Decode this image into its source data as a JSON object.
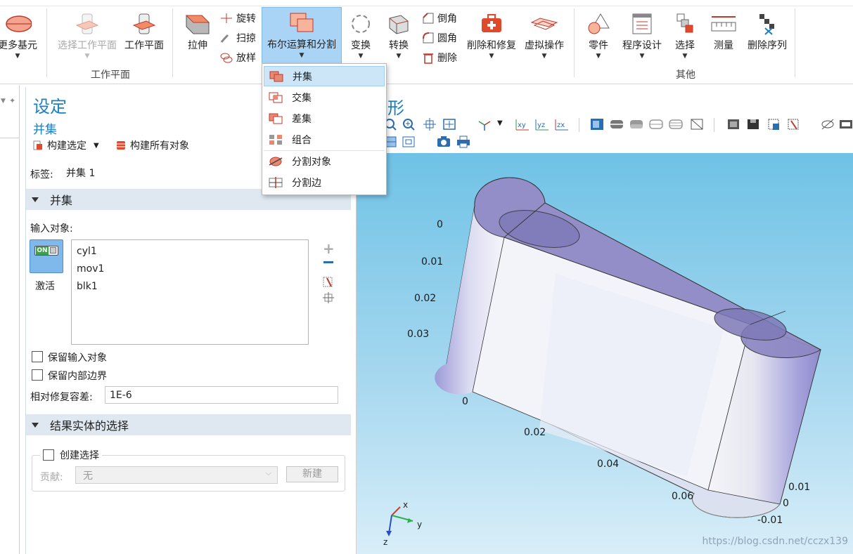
{
  "ribbon": {
    "more_primitives": "更多基元",
    "select_workplane": "选择工作平面",
    "workplane": "工作平面",
    "workplane_group": "工作平面",
    "extrude": "拉伸",
    "revolve": "旋转",
    "sweep": "扫掠",
    "loft": "放样",
    "booleans": "布尔运算和分割",
    "transforms": "变换",
    "conversions": "转换",
    "chamfer": "倒角",
    "fillet": "圆角",
    "delete": "删除",
    "defeaturing": "削除和修复",
    "virtual_ops": "虚拟操作",
    "parts": "零件",
    "programming": "程序设计",
    "selections": "选择",
    "measure": "测量",
    "delete_sequence": "删除序列",
    "other_group": "其他"
  },
  "dropdown": {
    "items": [
      {
        "label": "并集",
        "icon": "union-icon",
        "selected": true
      },
      {
        "label": "交集",
        "icon": "intersection-icon",
        "selected": false
      },
      {
        "label": "差集",
        "icon": "difference-icon",
        "selected": false
      },
      {
        "label": "组合",
        "icon": "compose-icon",
        "selected": false
      },
      {
        "label": "分割对象",
        "icon": "partition-objects-icon",
        "selected": false
      },
      {
        "label": "分割边",
        "icon": "partition-edges-icon",
        "selected": false
      }
    ]
  },
  "settings": {
    "title": "设定",
    "subtitle": "并集",
    "build_selected": "构建选定",
    "build_all": "构建所有对象",
    "label_caption": "标签:",
    "label_value": "并集 1",
    "section_union": "并集",
    "input_objects_caption": "输入对象:",
    "toggle_state": "ON",
    "activate": "激活",
    "input_objects": [
      "cyl1",
      "mov1",
      "blk1"
    ],
    "keep_input": "保留输入对象",
    "keep_interior": "保留内部边界",
    "repair_tol_caption": "相对修复容差:",
    "repair_tol_value": "1E-6",
    "section_result": "结果实体的选择",
    "create_selection": "创建选择",
    "contribute_caption": "贡献:",
    "contribute_value": "无",
    "new_button": "新建"
  },
  "graphics": {
    "title_fragment": "形",
    "axis_numbers": [
      "0",
      "0.01",
      "0.02",
      "0.03",
      "0",
      "0.02",
      "0.04",
      "0.06",
      "0.01",
      "0",
      "-0.01"
    ],
    "triad": {
      "x": "x",
      "y": "y",
      "z": "z"
    },
    "watermark": "https://blog.csdn.net/cczx139"
  },
  "colors": {
    "accent_blue": "#1a7fc1",
    "ribbon_selected": "#a9d4f5",
    "section_header": "#dfe8f1",
    "geometry_fill": "#8e88c4"
  }
}
